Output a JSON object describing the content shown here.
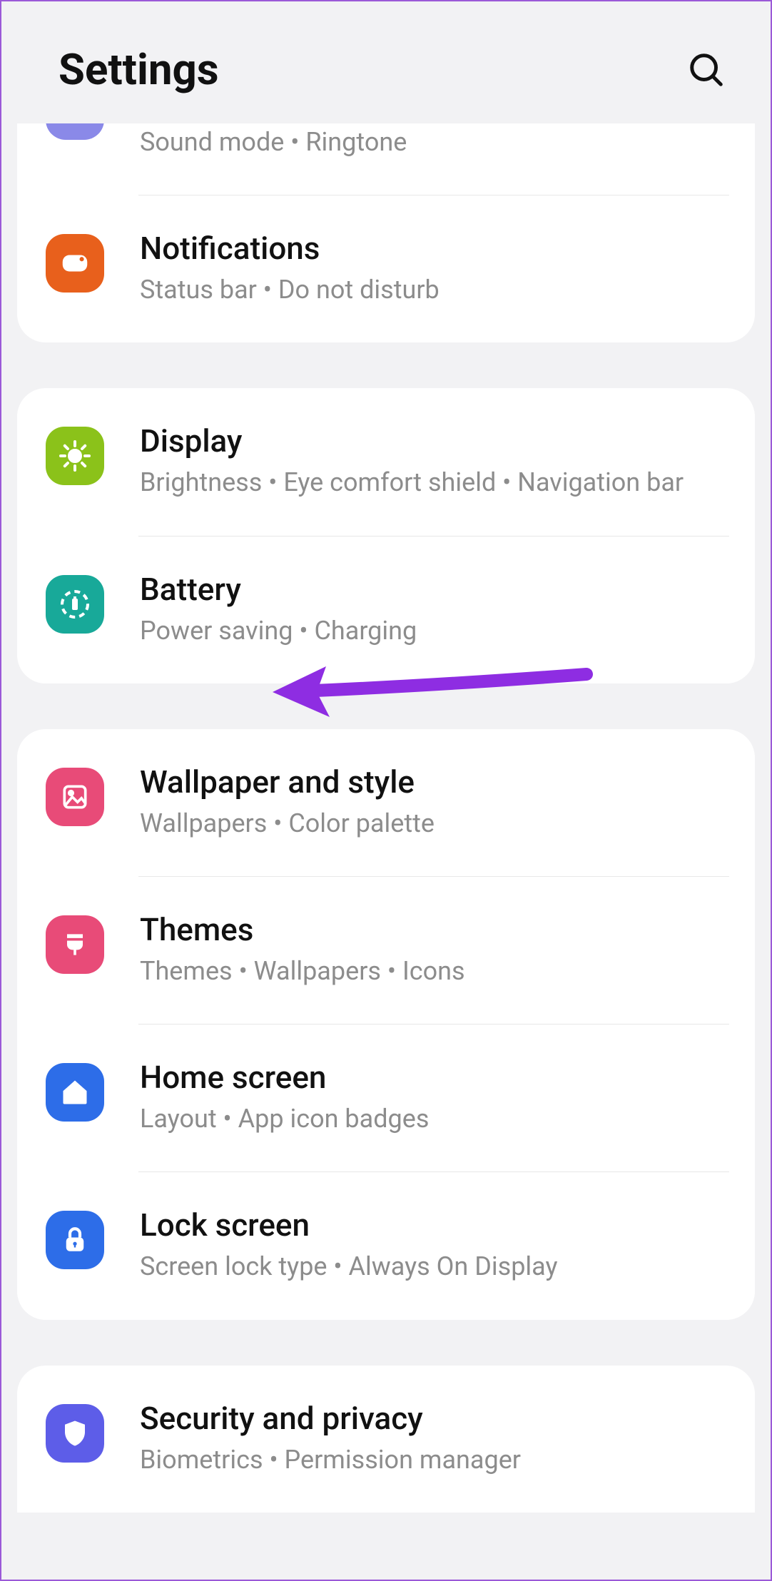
{
  "header": {
    "title": "Settings"
  },
  "groups": [
    {
      "items": [
        {
          "id": "sounds",
          "partial": true,
          "sub": "Sound mode  •  Ringtone"
        },
        {
          "id": "notifications",
          "title": "Notifications",
          "sub": "Status bar  •  Do not disturb",
          "icon_color": "#e8601c"
        }
      ]
    },
    {
      "items": [
        {
          "id": "display",
          "title": "Display",
          "sub": "Brightness  •  Eye comfort shield  •  Navigation bar",
          "icon_color": "#8bc21a"
        },
        {
          "id": "battery",
          "title": "Battery",
          "sub": "Power saving  •  Charging",
          "icon_color": "#18a999"
        }
      ]
    },
    {
      "items": [
        {
          "id": "wallpaper",
          "title": "Wallpaper and style",
          "sub": "Wallpapers  •  Color palette",
          "icon_color": "#e84b78"
        },
        {
          "id": "themes",
          "title": "Themes",
          "sub": "Themes  •  Wallpapers  •  Icons",
          "icon_color": "#e84b78"
        },
        {
          "id": "homescreen",
          "title": "Home screen",
          "sub": "Layout  •  App icon badges",
          "icon_color": "#2d6de8"
        },
        {
          "id": "lockscreen",
          "title": "Lock screen",
          "sub": "Screen lock type  •  Always On Display",
          "icon_color": "#2d6de8"
        }
      ]
    },
    {
      "items": [
        {
          "id": "security",
          "title": "Security and privacy",
          "sub": "Biometrics  •  Permission manager",
          "icon_color": "#5d5de8"
        }
      ]
    }
  ]
}
